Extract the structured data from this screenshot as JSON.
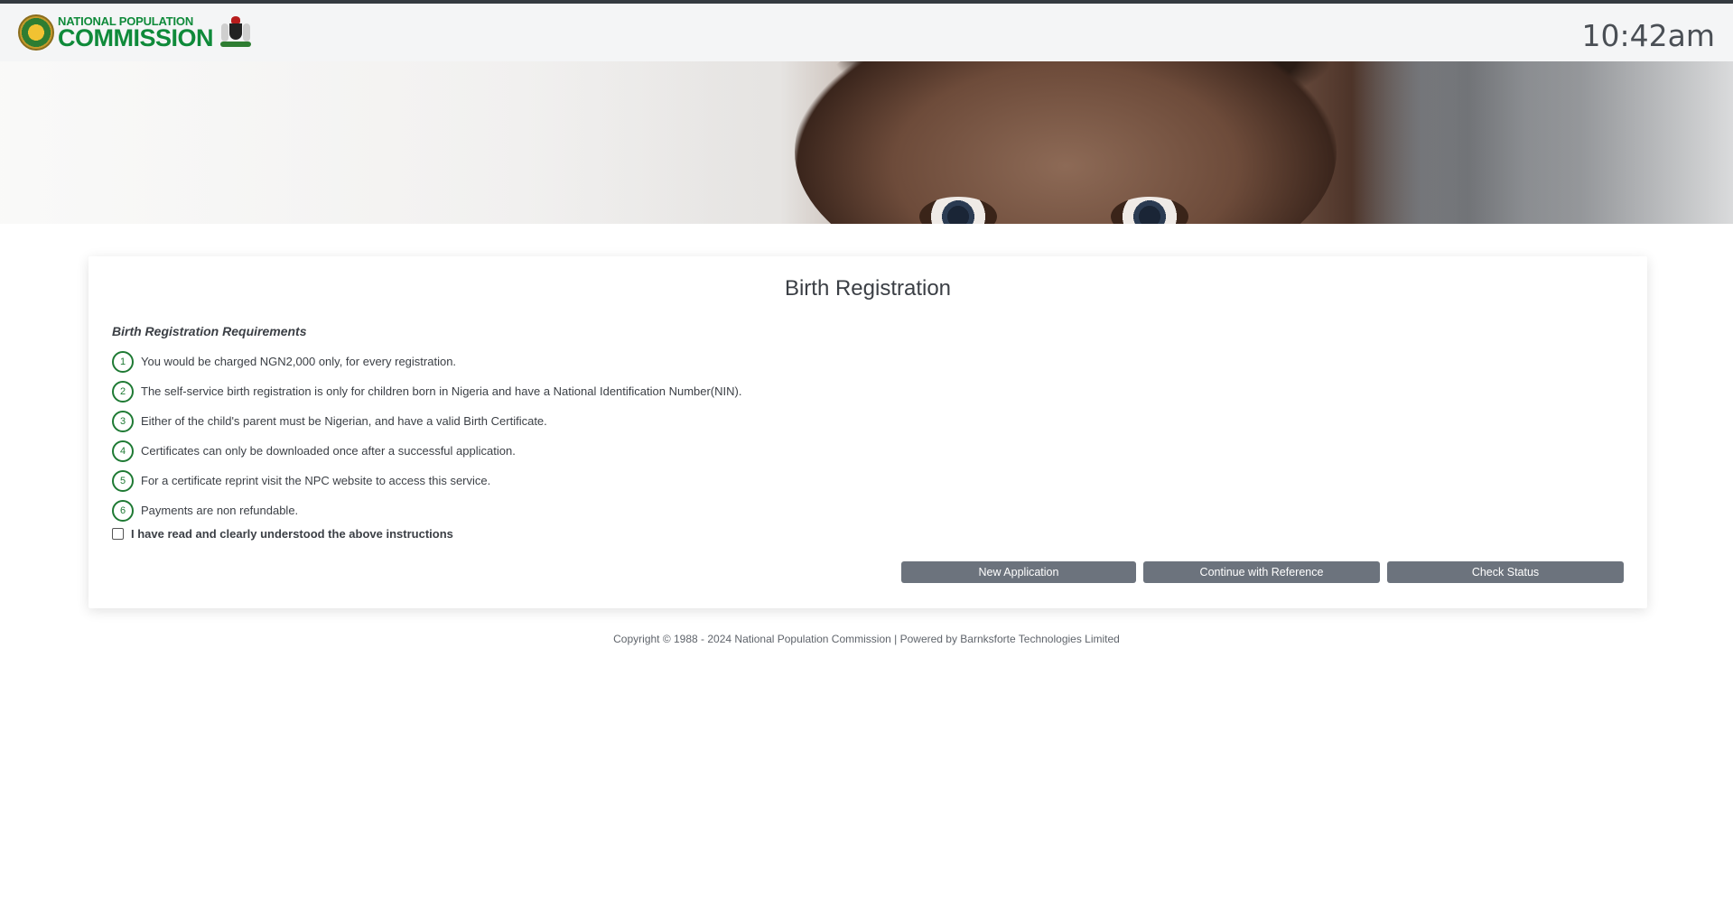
{
  "header": {
    "logo_line1": "NATIONAL POPULATION",
    "logo_line2": "COMMISSION",
    "clock": "10:42am"
  },
  "card": {
    "title": "Birth Registration",
    "requirements_heading": "Birth Registration Requirements",
    "requirements": [
      {
        "number": "1",
        "text": "You would be charged NGN2,000 only, for every registration."
      },
      {
        "number": "2",
        "text": "The self-service birth registration is only for children born in Nigeria and have a National Identification Number(NIN)."
      },
      {
        "number": "3",
        "text": "Either of the child's parent must be Nigerian, and have a valid Birth Certificate."
      },
      {
        "number": "4",
        "text": "Certificates can only be downloaded once after a successful application."
      },
      {
        "number": "5",
        "text": "For a certificate reprint visit the NPC website to access this service."
      },
      {
        "number": "6",
        "text": "Payments are non refundable."
      }
    ],
    "agreement_label": "I have read and clearly understood the above instructions",
    "agreement_checked": false
  },
  "buttons": {
    "new_application": "New Application",
    "continue_reference": "Continue with Reference",
    "check_status": "Check Status"
  },
  "footer": {
    "copyright": "Copyright © 1988 - 2024 National Population Commission | Powered by Barnksforte Technologies Limited"
  },
  "colors": {
    "brand_green": "#0f8a3a",
    "number_ring": "#1f7a34",
    "button_bg": "#6c737d",
    "header_bg": "#f4f5f6"
  },
  "icons": {
    "logo": "npc-seal-icon",
    "coat_of_arms": "coat-of-arms-icon"
  }
}
